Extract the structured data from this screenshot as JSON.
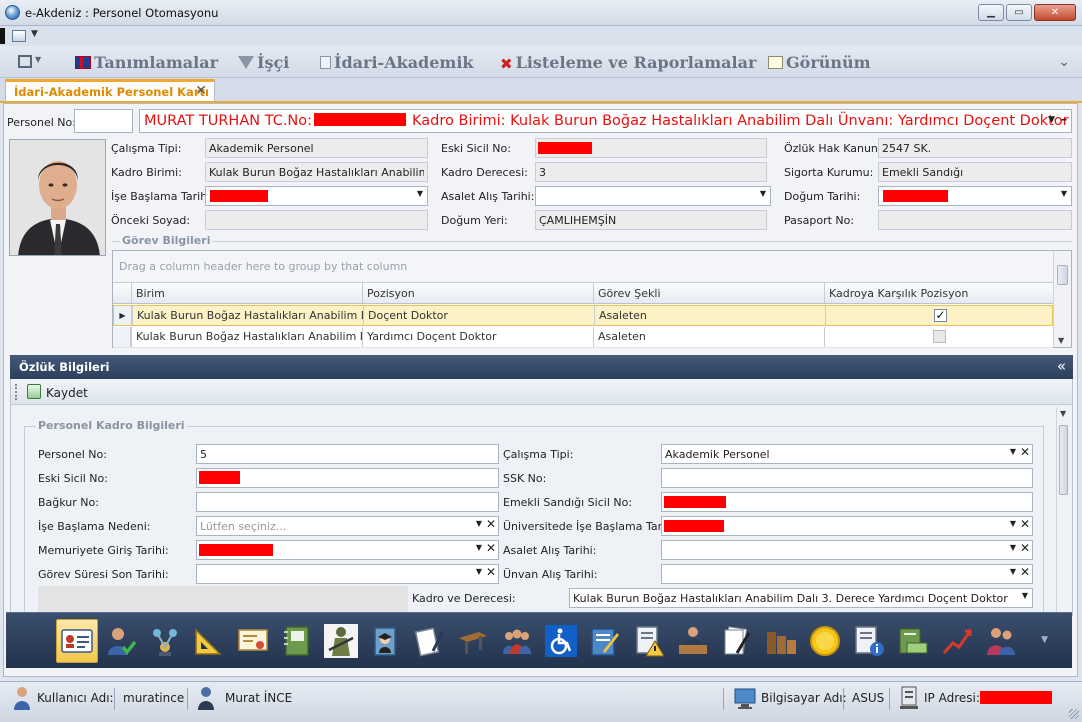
{
  "window": {
    "title": "e-Akdeniz : Personel Otomasyonu",
    "controls": {
      "minimize": "▁",
      "maximize": "▭",
      "close": "✕"
    }
  },
  "menu": {
    "items": [
      {
        "label": "Tanımlamalar",
        "icon": "flag-icon"
      },
      {
        "label": "İşçi",
        "icon": "funnel-icon"
      },
      {
        "label": "İdari-Akademik",
        "icon": "document-icon"
      },
      {
        "label": "Listeleme ve Raporlamalar",
        "icon": "red-x-icon"
      },
      {
        "label": "Görünüm",
        "icon": "window-icon"
      }
    ]
  },
  "tab": {
    "label": "İdari-Akademik Personel Kartı",
    "close": "✕"
  },
  "personel": {
    "no_label": "Personel No:",
    "no_value": "",
    "selector_name": "MURAT TURHAN  TC.No:",
    "selector_rest": "Kadro Birimi: Kulak Burun Boğaz Hastalıkları Anabilim Dalı  Ünvanı: Yardımcı Doçent Doktor"
  },
  "info": {
    "calisma_tipi_label": "Çalışma Tipi:",
    "calisma_tipi": "Akademik Personel",
    "kadro_birimi_label": "Kadro Birimi:",
    "kadro_birimi": "Kulak Burun Boğaz Hastalıkları Anabilim Dalı",
    "ise_baslama_label": "İşe Başlama Tarihi:",
    "onceki_soyad_label": "Önceki Soyad:",
    "onceki_soyad": "",
    "eski_sicil_label": "Eski Sicil No:",
    "kadro_derecesi_label": "Kadro Derecesi:",
    "kadro_derecesi": "3",
    "asalet_label": "Asalet Alış Tarihi:",
    "asalet": "",
    "dogum_yeri_label": "Doğum Yeri:",
    "dogum_yeri": "ÇAMLIHEMŞİN",
    "ozluk_kanun_label": "Özlük Hak Kanunu:",
    "ozluk_kanun": "2547 SK.",
    "sigorta_label": "Sigorta Kurumu:",
    "sigorta": "Emekli Sandığı",
    "dogum_tarihi_label": "Doğum Tarihi:",
    "pasaport_label": "Pasaport No:",
    "pasaport": ""
  },
  "gorev": {
    "title": "Görev Bilgileri",
    "group_hint": "Drag a column header here to group by that column",
    "columns": [
      "Birim",
      "Pozisyon",
      "Görev Şekli",
      "Kadroya Karşılık Pozisyon"
    ],
    "rows": [
      {
        "birim": "Kulak Burun Boğaz Hastalıkları Anabilim Dalı",
        "pozisyon": "Doçent Doktor",
        "sekil": "Asaleten",
        "kadroya": true
      },
      {
        "birim": "Kulak Burun Boğaz Hastalıkları Anabilim Dalı",
        "pozisyon": "Yardımcı Doçent Doktor",
        "sekil": "Asaleten",
        "kadroya": false
      }
    ]
  },
  "ozluk": {
    "title": "Özlük Bilgileri",
    "save_label": "Kaydet",
    "section_title": "Personel Kadro Bilgileri",
    "personel_no_label": "Personel No:",
    "personel_no": "5",
    "eski_sicil_label": "Eski Sicil No:",
    "bagkur_label": "Bağkur No:",
    "bagkur": "",
    "ise_baslama_nedeni_label": "İşe Başlama Nedeni:",
    "ise_baslama_nedeni_placeholder": "Lütfen seçiniz...",
    "memuriyet_label": "Memuriyete Giriş Tarihi:",
    "gorev_suresi_label": "Görev Süresi Son Tarihi:",
    "gorev_suresi": "",
    "calisma_tipi_label": "Çalışma Tipi:",
    "calisma_tipi": "Akademik Personel",
    "ssk_label": "SSK No:",
    "ssk": "",
    "emekli_sicil_label": "Emekli Sandığı Sicil No:",
    "universite_label": "Üniversitede İşe Başlama Tarihi:",
    "asalet_label": "Asalet Alış Tarihi:",
    "asalet": "",
    "unvan_label": "Ünvan Alış Tarihi:",
    "unvan": "",
    "kadro_derece_label": "Kadro ve Derecesi:",
    "kadro_derece": "Kulak Burun Boğaz Hastalıkları Anabilim Dalı 3. Derece Yardımcı Doçent Doktor"
  },
  "dock": {
    "items": [
      "id-card-icon",
      "user-check-icon",
      "network-icon",
      "ruler-icon",
      "certificate-icon",
      "notebook-icon",
      "soldier-icon",
      "graduate-book-icon",
      "signing-icon",
      "school-desk-icon",
      "group-icon",
      "wheelchair-icon",
      "edit-doc-icon",
      "warning-doc-icon",
      "desk-worker-icon",
      "paper-stack-icon",
      "archive-icon",
      "gold-coin-icon",
      "info-doc-icon",
      "money-icon",
      "growth-chart-icon",
      "family-icon"
    ]
  },
  "status": {
    "user_label": "Kullanıcı Adı:",
    "user": "muratince",
    "full_name": "Murat İNCE",
    "computer_label": "Bilgisayar Adı:",
    "computer": "ASUS",
    "ip_label": "IP Adresi:"
  },
  "colors": {
    "accent": "#f0a830",
    "redacted": "#ff0000",
    "header_dark": "#2c3f5c"
  }
}
